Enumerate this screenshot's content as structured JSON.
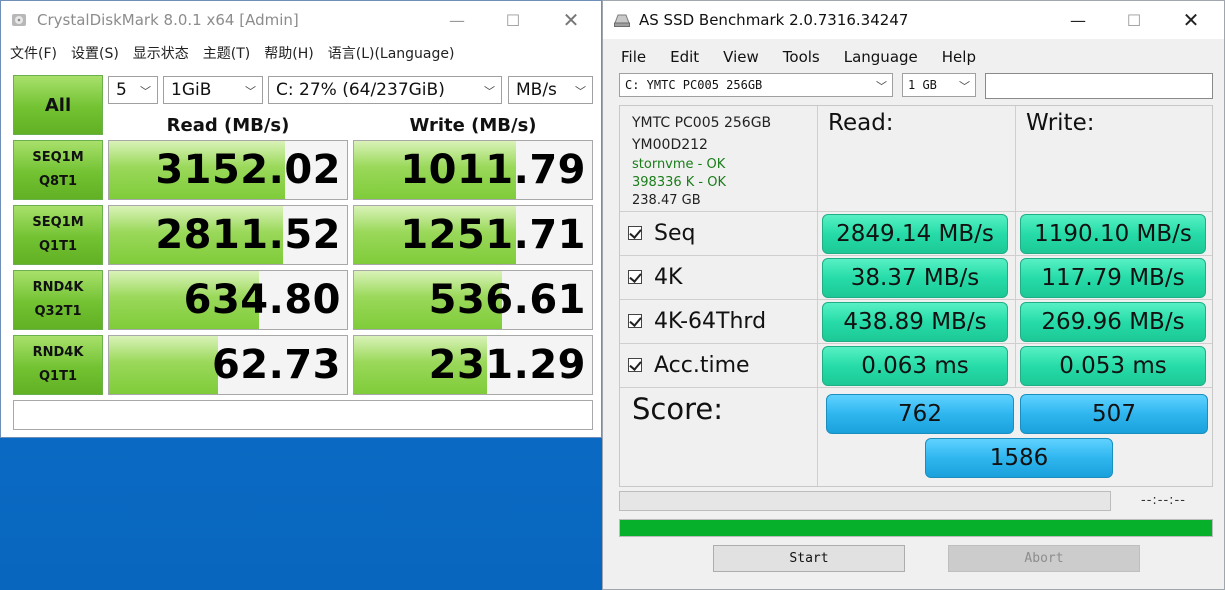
{
  "cdm": {
    "title": "CrystalDiskMark 8.0.1 x64 [Admin]",
    "menu": [
      "文件(F)",
      "设置(S)",
      "显示状态",
      "主题(T)",
      "帮助(H)",
      "语言(L)(Language)"
    ],
    "all_label": "All",
    "count": "5",
    "size": "1GiB",
    "drive": "C: 27% (64/237GiB)",
    "unit": "MB/s",
    "read_header": "Read (MB/s)",
    "write_header": "Write (MB/s)",
    "rows": [
      {
        "line1": "SEQ1M",
        "line2": "Q8T1",
        "read": "3152.02",
        "write": "1011.79",
        "read_fill": 0.74,
        "write_fill": 0.68
      },
      {
        "line1": "SEQ1M",
        "line2": "Q1T1",
        "read": "2811.52",
        "write": "1251.71",
        "read_fill": 0.73,
        "write_fill": 0.68
      },
      {
        "line1": "RND4K",
        "line2": "Q32T1",
        "read": "634.80",
        "write": "536.61",
        "read_fill": 0.63,
        "write_fill": 0.62
      },
      {
        "line1": "RND4K",
        "line2": "Q1T1",
        "read": "62.73",
        "write": "231.29",
        "read_fill": 0.46,
        "write_fill": 0.56
      }
    ],
    "colors": {
      "accent_green": "#72c232",
      "fill_green": "#9ad85a"
    }
  },
  "asssd": {
    "title": "AS SSD Benchmark 2.0.7316.34247",
    "menu": [
      "File",
      "Edit",
      "View",
      "Tools",
      "Language",
      "Help"
    ],
    "drive_select": "C: YMTC PC005 256GB",
    "size_select": "1 GB",
    "device": {
      "model": "YMTC PC005 256GB",
      "firmware": "YM00D212",
      "driver": "stornvme - OK",
      "alignment": "398336 K - OK",
      "capacity": "238.47 GB"
    },
    "read_header": "Read:",
    "write_header": "Write:",
    "tests": [
      {
        "label": "Seq",
        "read": "2849.14 MB/s",
        "write": "1190.10 MB/s"
      },
      {
        "label": "4K",
        "read": "38.37 MB/s",
        "write": "117.79 MB/s"
      },
      {
        "label": "4K-64Thrd",
        "read": "438.89 MB/s",
        "write": "269.96 MB/s"
      },
      {
        "label": "Acc.time",
        "read": "0.063 ms",
        "write": "0.053 ms"
      }
    ],
    "score_label": "Score:",
    "score_read": "762",
    "score_write": "507",
    "score_total": "1586",
    "time_readout": "--:--:--",
    "progress_fraction": 1.0,
    "start_label": "Start",
    "abort_label": "Abort",
    "colors": {
      "result_green": "#26dca8",
      "score_blue": "#2fb6ef",
      "progress_green": "#07b02a"
    }
  }
}
